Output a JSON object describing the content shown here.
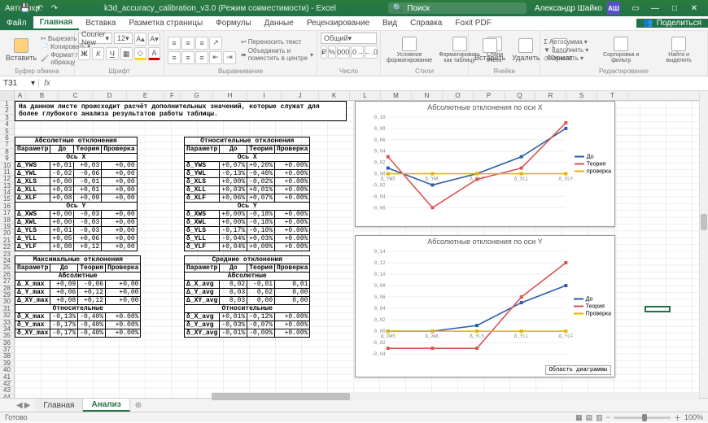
{
  "titlebar": {
    "autosave": "Автосохр.",
    "doc": "k3d_accuracy_calibration_v3.0  (Режим совместимости)  -  Excel",
    "search_placeholder": "Поиск",
    "user": "Александр Шайко",
    "avatar": "АШ"
  },
  "menu": {
    "file": "Файл",
    "tabs": [
      "Главная",
      "Вставка",
      "Разметка страницы",
      "Формулы",
      "Данные",
      "Рецензирование",
      "Вид",
      "Справка",
      "Foxit PDF"
    ],
    "share": "Поделиться"
  },
  "ribbon": {
    "paste": "Вставить",
    "cut": "Вырезать",
    "copy": "Копировать",
    "format_painter": "Формат по образцу",
    "g_clipboard": "Буфер обмена",
    "font": "Courier New",
    "font_size": "12",
    "g_font": "Шрифт",
    "wrap": "Переносить текст",
    "merge": "Объединить и поместить в центре",
    "g_align": "Выравнивание",
    "num_format": "Общий",
    "g_number": "Число",
    "cond": "Условное форматирование",
    "as_table": "Форматировать как таблицу",
    "styles": "Стили ячеек",
    "g_styles": "Стили",
    "insert": "Вставить",
    "delete": "Удалить",
    "format": "Формат",
    "g_cells": "Ячейки",
    "autosum": "Автосумма",
    "fill": "Заполнить",
    "clear": "Очистить",
    "sort": "Сортировка и фильтр",
    "find": "Найти и выделить",
    "g_edit": "Редактирование"
  },
  "formula_bar": {
    "name": "T31",
    "value": ""
  },
  "columns": [
    "A",
    "B",
    "C",
    "D",
    "E",
    "F",
    "G",
    "H",
    "I",
    "J",
    "K",
    "L",
    "M",
    "N",
    "O",
    "P",
    "Q",
    "R",
    "S",
    "T"
  ],
  "row_start": 1,
  "row_end": 45,
  "intro": "На данном листе происходит расчёт дополнительных значений, которые служат для более глубокого анализа результатов работы таблицы.",
  "tables": {
    "abs": {
      "title": "Абсолютные отклонения",
      "param": "Параметр",
      "before": "До",
      "theory": "Теория",
      "check": "Проверка",
      "axisX": "Ось X",
      "rowsX": [
        [
          "Δ_YWS",
          "+0,01",
          "+0,03",
          "+0,00"
        ],
        [
          "Δ_YWL",
          "-0,02",
          "-0,06",
          "+0,00"
        ],
        [
          "Δ_XLS",
          "+0,00",
          "-0,01",
          "+0,00"
        ],
        [
          "Δ_XLL",
          "+0,03",
          "+0,01",
          "+0,00"
        ],
        [
          "Δ_XLF",
          "+0,08",
          "+0,09",
          "+0,00"
        ]
      ],
      "axisY": "Ось Y",
      "rowsY": [
        [
          "Δ_XWS",
          "+0,00",
          "-0,03",
          "+0,00"
        ],
        [
          "Δ_XWL",
          "+0,00",
          "-0,03",
          "+0,00"
        ],
        [
          "Δ_YLS",
          "+0,01",
          "-0,03",
          "+0,00"
        ],
        [
          "Δ_YLL",
          "+0,05",
          "+0,06",
          "+0,00"
        ],
        [
          "Δ_YLF",
          "+0,08",
          "+0,12",
          "+0,00"
        ]
      ]
    },
    "rel": {
      "title": "Относительные отклонения",
      "axisX": "Ось X",
      "rowsX": [
        [
          "δ_YWS",
          "+0,07%",
          "+0,20%",
          "+0.00%"
        ],
        [
          "δ_YWL",
          "-0,13%",
          "-0,40%",
          "+0.00%"
        ],
        [
          "δ_XLS",
          "+0,00%",
          "-0,02%",
          "+0.00%"
        ],
        [
          "δ_XLL",
          "+0,03%",
          "+0,01%",
          "+0.00%"
        ],
        [
          "δ_XLF",
          "+0,06%",
          "+0,07%",
          "+0.00%"
        ]
      ],
      "axisY": "Ось Y",
      "rowsY": [
        [
          "δ_XWS",
          "+0,00%",
          "-0,18%",
          "+0.00%"
        ],
        [
          "δ_XWL",
          "+0,00%",
          "-0,18%",
          "+0.00%"
        ],
        [
          "δ_YLS",
          "-0,17%",
          "-0,10%",
          "+0.00%"
        ],
        [
          "δ_YLL",
          "-0,04%",
          "+0,03%",
          "+0.00%"
        ],
        [
          "δ_YLF",
          "+0,04%",
          "+0,09%",
          "+0.00%"
        ]
      ]
    },
    "max": {
      "title": "Максимальные отклонения",
      "abs_lbl": "Абсолютные",
      "rel_lbl": "Относительные",
      "rows_abs": [
        [
          "Δ_X_max",
          "+0,09",
          "-0,06",
          "+0,00"
        ],
        [
          "Δ_Y_max",
          "+0,06",
          "+0,12",
          "+0,00"
        ],
        [
          "Δ_XY_max",
          "+0,08",
          "+0,12",
          "+0,00"
        ]
      ],
      "rows_rel": [
        [
          "δ_X_max",
          "-0,13%",
          "-0,40%",
          "+0.00%"
        ],
        [
          "δ_Y_max",
          "-0,17%",
          "-0,40%",
          "+0.00%"
        ],
        [
          "δ_XY_max",
          "-0,17%",
          "-0,40%",
          "+0.00%"
        ]
      ]
    },
    "avg": {
      "title": "Средние отклонения",
      "rows_abs": [
        [
          "Δ_X_avg",
          "0,02",
          "-0,01",
          "0,01"
        ],
        [
          "Δ_Y_avg",
          "0,03",
          "0,02",
          "0,00"
        ],
        [
          "Δ_XY_avg",
          "0,03",
          "0,00",
          "0,00"
        ]
      ],
      "rows_rel": [
        [
          "δ_X_avg",
          "+0,01%",
          "-0,12%",
          "+0.00%"
        ],
        [
          "δ_Y_avg",
          "-0,03%",
          "-0,07%",
          "+0.00%"
        ],
        [
          "δ_XY_avg",
          "-0,01%",
          "-0,09%",
          "+0.00%"
        ]
      ]
    }
  },
  "chart_data": [
    {
      "type": "line",
      "title": "Абсолютные отклонения по оси X",
      "categories": [
        "Δ_YWS",
        "Δ_YWL",
        "Δ_XLS",
        "Δ_XLL",
        "Δ_XLF"
      ],
      "series": [
        {
          "name": "До",
          "color": "#2a5caa",
          "values": [
            0.01,
            -0.02,
            0.0,
            0.03,
            0.08
          ]
        },
        {
          "name": "Теория",
          "color": "#d9534f",
          "values": [
            0.03,
            -0.06,
            -0.01,
            0.01,
            0.09
          ]
        },
        {
          "name": "проверка",
          "color": "#e0b400",
          "values": [
            0.0,
            0.0,
            0.0,
            0.0,
            0.0
          ]
        }
      ],
      "ylim": [
        -0.06,
        0.1
      ],
      "yticks": [
        -0.06,
        -0.04,
        -0.02,
        0.0,
        0.02,
        0.04,
        0.06,
        0.08,
        0.1
      ]
    },
    {
      "type": "line",
      "title": "Абсолютные отклонения по оси Y",
      "categories": [
        "Δ_XWS",
        "Δ_XWL",
        "Δ_YLS",
        "Δ_YLL",
        "Δ_YLF"
      ],
      "series": [
        {
          "name": "До",
          "color": "#2a5caa",
          "values": [
            0.0,
            0.0,
            0.01,
            0.05,
            0.08
          ]
        },
        {
          "name": "Теория",
          "color": "#d9534f",
          "values": [
            -0.03,
            -0.03,
            -0.03,
            0.06,
            0.12
          ]
        },
        {
          "name": "Проверка",
          "color": "#e0b400",
          "values": [
            0.0,
            0.0,
            0.0,
            0.0,
            0.0
          ]
        }
      ],
      "ylim": [
        -0.04,
        0.14
      ],
      "yticks": [
        -0.04,
        -0.02,
        0.0,
        0.02,
        0.04,
        0.06,
        0.08,
        0.1,
        0.12,
        0.14
      ]
    }
  ],
  "chart_ui": {
    "area_btn": "Область диаграммы"
  },
  "sheets": {
    "tabs": [
      "Главная",
      "Анализ"
    ],
    "active": 1
  },
  "status": {
    "ready": "Готово",
    "zoom": "100%"
  },
  "selection": "T31"
}
